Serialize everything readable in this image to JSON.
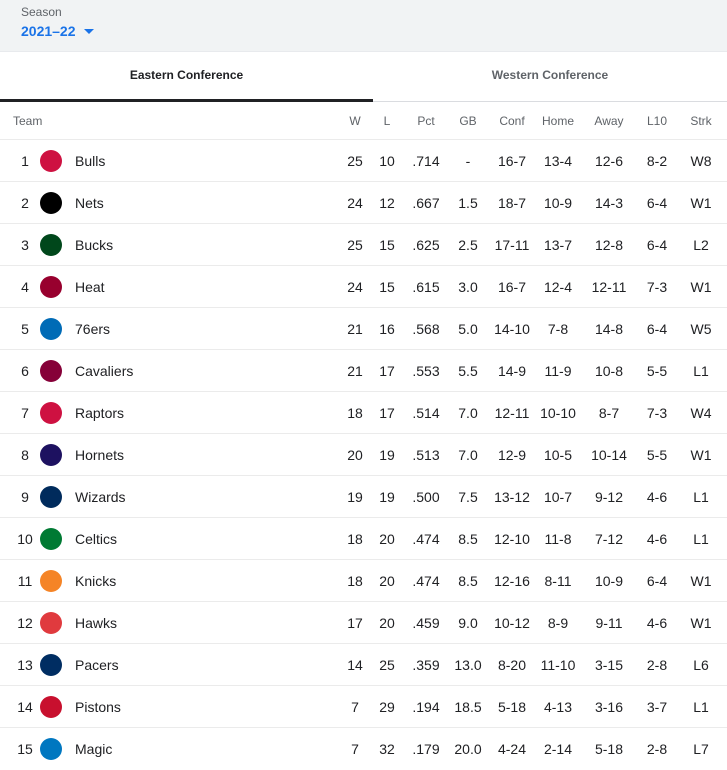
{
  "season": {
    "label": "Season",
    "value": "2021–22"
  },
  "tabs": [
    {
      "label": "Eastern Conference",
      "active": true
    },
    {
      "label": "Western Conference",
      "active": false
    }
  ],
  "columns": [
    "Team",
    "W",
    "L",
    "Pct",
    "GB",
    "Conf",
    "Home",
    "Away",
    "L10",
    "Strk"
  ],
  "teams": [
    {
      "rank": "1",
      "name": "Bulls",
      "w": "25",
      "l": "10",
      "pct": ".714",
      "gb": "-",
      "conf": "16-7",
      "home": "13-4",
      "away": "12-6",
      "l10": "8-2",
      "strk": "W8",
      "logo": "bulls-logo-icon",
      "color": "#ce1141"
    },
    {
      "rank": "2",
      "name": "Nets",
      "w": "24",
      "l": "12",
      "pct": ".667",
      "gb": "1.5",
      "conf": "18-7",
      "home": "10-9",
      "away": "14-3",
      "l10": "6-4",
      "strk": "W1",
      "logo": "nets-logo-icon",
      "color": "#000000"
    },
    {
      "rank": "3",
      "name": "Bucks",
      "w": "25",
      "l": "15",
      "pct": ".625",
      "gb": "2.5",
      "conf": "17-11",
      "home": "13-7",
      "away": "12-8",
      "l10": "6-4",
      "strk": "L2",
      "logo": "bucks-logo-icon",
      "color": "#00471b"
    },
    {
      "rank": "4",
      "name": "Heat",
      "w": "24",
      "l": "15",
      "pct": ".615",
      "gb": "3.0",
      "conf": "16-7",
      "home": "12-4",
      "away": "12-11",
      "l10": "7-3",
      "strk": "W1",
      "logo": "heat-logo-icon",
      "color": "#98002e"
    },
    {
      "rank": "5",
      "name": "76ers",
      "w": "21",
      "l": "16",
      "pct": ".568",
      "gb": "5.0",
      "conf": "14-10",
      "home": "7-8",
      "away": "14-8",
      "l10": "6-4",
      "strk": "W5",
      "logo": "76ers-logo-icon",
      "color": "#006bb6"
    },
    {
      "rank": "6",
      "name": "Cavaliers",
      "w": "21",
      "l": "17",
      "pct": ".553",
      "gb": "5.5",
      "conf": "14-9",
      "home": "11-9",
      "away": "10-8",
      "l10": "5-5",
      "strk": "L1",
      "logo": "cavaliers-logo-icon",
      "color": "#860038"
    },
    {
      "rank": "7",
      "name": "Raptors",
      "w": "18",
      "l": "17",
      "pct": ".514",
      "gb": "7.0",
      "conf": "12-11",
      "home": "10-10",
      "away": "8-7",
      "l10": "7-3",
      "strk": "W4",
      "logo": "raptors-logo-icon",
      "color": "#ce1141"
    },
    {
      "rank": "8",
      "name": "Hornets",
      "w": "20",
      "l": "19",
      "pct": ".513",
      "gb": "7.0",
      "conf": "12-9",
      "home": "10-5",
      "away": "10-14",
      "l10": "5-5",
      "strk": "W1",
      "logo": "hornets-logo-icon",
      "color": "#1d1160"
    },
    {
      "rank": "9",
      "name": "Wizards",
      "w": "19",
      "l": "19",
      "pct": ".500",
      "gb": "7.5",
      "conf": "13-12",
      "home": "10-7",
      "away": "9-12",
      "l10": "4-6",
      "strk": "L1",
      "logo": "wizards-logo-icon",
      "color": "#002b5c"
    },
    {
      "rank": "10",
      "name": "Celtics",
      "w": "18",
      "l": "20",
      "pct": ".474",
      "gb": "8.5",
      "conf": "12-10",
      "home": "11-8",
      "away": "7-12",
      "l10": "4-6",
      "strk": "L1",
      "logo": "celtics-logo-icon",
      "color": "#007a33"
    },
    {
      "rank": "11",
      "name": "Knicks",
      "w": "18",
      "l": "20",
      "pct": ".474",
      "gb": "8.5",
      "conf": "12-16",
      "home": "8-11",
      "away": "10-9",
      "l10": "6-4",
      "strk": "W1",
      "logo": "knicks-logo-icon",
      "color": "#f58426"
    },
    {
      "rank": "12",
      "name": "Hawks",
      "w": "17",
      "l": "20",
      "pct": ".459",
      "gb": "9.0",
      "conf": "10-12",
      "home": "8-9",
      "away": "9-11",
      "l10": "4-6",
      "strk": "W1",
      "logo": "hawks-logo-icon",
      "color": "#e03a3e"
    },
    {
      "rank": "13",
      "name": "Pacers",
      "w": "14",
      "l": "25",
      "pct": ".359",
      "gb": "13.0",
      "conf": "8-20",
      "home": "11-10",
      "away": "3-15",
      "l10": "2-8",
      "strk": "L6",
      "logo": "pacers-logo-icon",
      "color": "#002d62"
    },
    {
      "rank": "14",
      "name": "Pistons",
      "w": "7",
      "l": "29",
      "pct": ".194",
      "gb": "18.5",
      "conf": "5-18",
      "home": "4-13",
      "away": "3-16",
      "l10": "3-7",
      "strk": "L1",
      "logo": "pistons-logo-icon",
      "color": "#c8102e"
    },
    {
      "rank": "15",
      "name": "Magic",
      "w": "7",
      "l": "32",
      "pct": ".179",
      "gb": "20.0",
      "conf": "4-24",
      "home": "2-14",
      "away": "5-18",
      "l10": "2-8",
      "strk": "L7",
      "logo": "magic-logo-icon",
      "color": "#0077c0"
    }
  ]
}
